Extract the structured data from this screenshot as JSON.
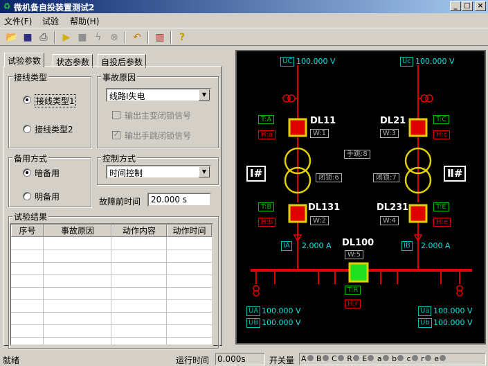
{
  "window": {
    "title": "微机备自投装置测试2",
    "min": "_",
    "max": "□",
    "close": "×"
  },
  "menu": [
    "文件(F)",
    "试验",
    "帮助(H)"
  ],
  "toolbar": {
    "icons": [
      "open-icon",
      "save-icon",
      "print-icon",
      "run-icon",
      "stop-icon",
      "lightning-icon",
      "cancel-icon",
      "undo-icon",
      "compare-icon",
      "help-icon"
    ]
  },
  "tabs": [
    "试验参数",
    "状态参数",
    "自投后参数"
  ],
  "wiring": {
    "title": "接线类型",
    "opt1": "接线类型1",
    "opt2": "接线类型2",
    "selected": 1
  },
  "fault": {
    "title": "事故原因",
    "value": "线路Ⅰ失电",
    "chk1": "输出主变闭锁信号",
    "chk2": "输出手跳闭锁信号",
    "chk1_checked": false,
    "chk2_checked": true
  },
  "backup": {
    "title": "备用方式",
    "opt1": "暗备用",
    "opt2": "明备用",
    "selected": 1
  },
  "control": {
    "title": "控制方式",
    "value": "时间控制"
  },
  "prefault": {
    "label": "故障前时间",
    "value": "20.000 s"
  },
  "results": {
    "title": "试验结果",
    "columns": [
      "序号",
      "事故原因",
      "动作内容",
      "动作时间"
    ]
  },
  "diagram": {
    "uc_label": "UC",
    "uc_value": "100.000 V",
    "uc2_label": "Uc",
    "uc2_value": "100.000 V",
    "dl11": "DL11",
    "dl21": "DL21",
    "dl131": "DL131",
    "dl231": "DL231",
    "dl100": "DL100",
    "ta": "T:A",
    "ha": "H:a",
    "w1": "W:1",
    "tc": "T:C",
    "hc": "H:c",
    "w3": "W:3",
    "tb": "T:B",
    "hb": "H:b",
    "w2": "W:2",
    "te": "T:E",
    "he": "H:e",
    "w4": "W:4",
    "tr": "T:R",
    "hr": "H:r",
    "w5": "W:5",
    "manual": "手跳:8",
    "lock6": "闭锁:6",
    "lock7": "闭锁:7",
    "bus1": "Ⅰ#",
    "bus2": "Ⅱ#",
    "ia_label": "IA",
    "ia_value": "2.000 A",
    "ib_label": "IB",
    "ib_value": "2.000 A",
    "ua_label": "UA",
    "ua_value": "100.000 V",
    "ub_label": "UB",
    "ub_value": "100.000 V",
    "ua2_label": "Ua",
    "ua2_value": "100.000 V",
    "ub2_label": "Ub",
    "ub2_value": "100.000 V"
  },
  "status": {
    "ready": "就绪",
    "runtime_label": "运行时间",
    "runtime_value": "0.000s",
    "switch_label": "开关量",
    "switches": [
      "A",
      "B",
      "C",
      "R",
      "E",
      "a",
      "b",
      "c",
      "r",
      "e"
    ]
  }
}
